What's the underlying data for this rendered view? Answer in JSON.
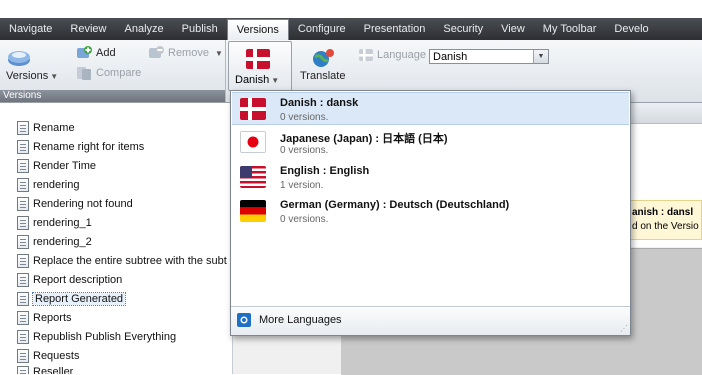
{
  "menubar": {
    "items": [
      {
        "label": "Navigate"
      },
      {
        "label": "Review"
      },
      {
        "label": "Analyze"
      },
      {
        "label": "Publish"
      },
      {
        "label": "Versions"
      },
      {
        "label": "Configure"
      },
      {
        "label": "Presentation"
      },
      {
        "label": "Security"
      },
      {
        "label": "View"
      },
      {
        "label": "My Toolbar"
      },
      {
        "label": "Develo"
      }
    ],
    "active": "Versions"
  },
  "ribbon": {
    "versions_group": {
      "add_label": "Add",
      "remove_label": "Remove",
      "compare_label": "Compare",
      "versions_label": "Versions",
      "footer_label": "Versions"
    },
    "language_group": {
      "current_label": "Danish",
      "translate_label": "Translate",
      "language_field_label": "Language",
      "language_value": "Danish"
    }
  },
  "tree": {
    "items": [
      {
        "label": "Rename"
      },
      {
        "label": "Rename right for items"
      },
      {
        "label": "Render Time"
      },
      {
        "label": "rendering"
      },
      {
        "label": "Rendering not found"
      },
      {
        "label": "rendering_1"
      },
      {
        "label": "rendering_2"
      },
      {
        "label": "Replace the entire subtree with the subt"
      },
      {
        "label": "Report description"
      },
      {
        "label": "Report Generated",
        "selected": true
      },
      {
        "label": "Reports"
      },
      {
        "label": "Republish Publish Everything"
      },
      {
        "label": "Requests"
      },
      {
        "label": "Reseller"
      }
    ]
  },
  "right_pane": {
    "notice_line1": "anish : dansl",
    "notice_line2": "d on the Versio"
  },
  "language_dropdown": {
    "items": [
      {
        "name": "Danish : dansk",
        "count": "0 versions.",
        "flag": "flag-denmark-icon",
        "highlighted": true
      },
      {
        "name": "Japanese (Japan) : 日本語 (日本)",
        "count": "0 versions.",
        "flag": "flag-japan-icon"
      },
      {
        "name": "English : English",
        "count": "1 version.",
        "flag": "flag-usa-icon"
      },
      {
        "name": "German (Germany) : Deutsch (Deutschland)",
        "count": "0 versions.",
        "flag": "flag-germany-icon"
      }
    ],
    "more_languages_label": "More Languages"
  },
  "colors": {
    "menubar_bg": "#3a3d42",
    "dropdown_highlight": "#dbe8f7",
    "danish_red": "#c8102e"
  }
}
